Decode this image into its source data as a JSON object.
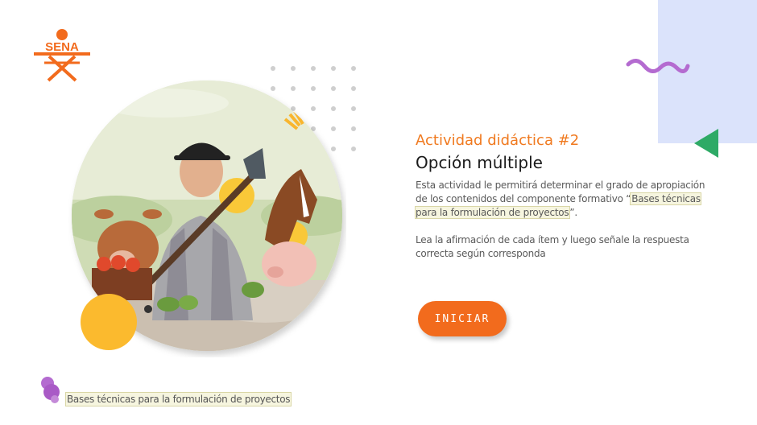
{
  "logo": {
    "text": "SENA"
  },
  "activity": {
    "title": "Actividad didáctica #2",
    "subtitle": "Opción múltiple",
    "description_pre": "Esta actividad le permitirá determinar el grado de apropiación de los contenidos del componente formativo “",
    "description_highlight": "Bases técnicas para la formulación de proyectos",
    "description_post": "”.",
    "instructions": "Lea la afirmación de cada ítem y luego señale la respuesta correcta según corresponda"
  },
  "start_button": {
    "label": "INICIAR"
  },
  "footer": {
    "course_name": "Bases técnicas para la formulación de proyectos"
  },
  "colors": {
    "accent": "#f26b1d",
    "title_orange": "#f07a20",
    "lavender_block": "#dbe3fb",
    "squiggle": "#b46bd0",
    "triangle": "#2eaa66",
    "yellow_circle": "#fbba2e"
  },
  "icons": [
    "sena-logo",
    "squiggle-decoration",
    "triangle-decoration",
    "dot-grid",
    "course-bubbles-icon"
  ]
}
